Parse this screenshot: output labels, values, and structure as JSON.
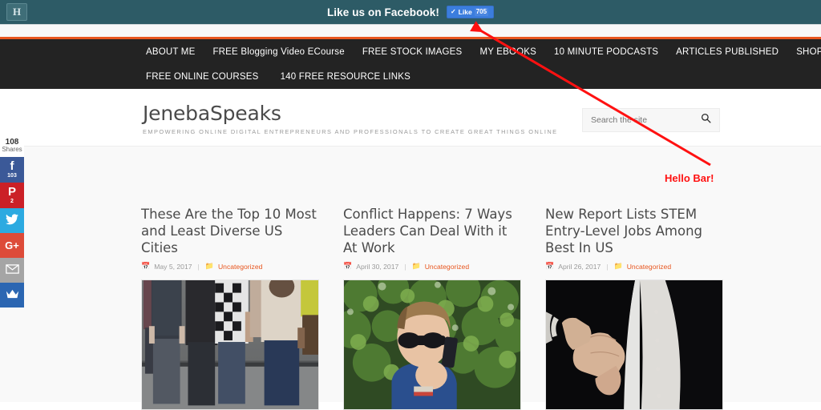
{
  "hellobar": {
    "logo_letter": "H",
    "message": "Like us on Facebook!",
    "like_button": {
      "check": "✓",
      "label": "Like",
      "count": "705"
    },
    "bar_color": "#2d5b66",
    "accent_color": "#e8561f"
  },
  "nav": {
    "row1": [
      {
        "label": "ABOUT ME"
      },
      {
        "label": "FREE Blogging Video ECourse"
      },
      {
        "label": "FREE STOCK IMAGES"
      },
      {
        "label": "MY EBOOKS"
      },
      {
        "label": "10 MINUTE PODCASTS"
      },
      {
        "label": "ARTICLES PUBLISHED"
      },
      {
        "label": "SHOP!"
      }
    ],
    "row2": [
      {
        "label": "FREE ONLINE COURSES"
      },
      {
        "label": "140 FREE RESOURCE LINKS"
      }
    ]
  },
  "masthead": {
    "site_title": "JenebaSpeaks",
    "tagline": "EMPOWERING ONLINE DIGITAL ENTREPRENEURS AND PROFESSIONALS TO CREATE GREAT THINGS ONLINE",
    "search": {
      "placeholder": "Search the site",
      "value": "",
      "icon": "search-icon"
    }
  },
  "share_rail": {
    "total_count": "108",
    "total_label": "Shares",
    "buttons": [
      {
        "network": "facebook",
        "glyph": "f",
        "count": "103",
        "color": "#3b5998"
      },
      {
        "network": "pinterest",
        "glyph": "P",
        "count": "2",
        "color": "#cb2027"
      },
      {
        "network": "twitter",
        "glyph": "🐦",
        "count": "",
        "color": "#2caae1"
      },
      {
        "network": "googleplus",
        "glyph": "G+",
        "count": "",
        "color": "#dd4b39"
      },
      {
        "network": "email",
        "glyph": "✉",
        "count": "",
        "color": "#a5a5a5"
      },
      {
        "network": "more",
        "glyph": "♛",
        "count": "",
        "color": "#2b66b2"
      }
    ]
  },
  "posts": [
    {
      "title": "These Are the Top 10 Most and Least Diverse US Cities",
      "date": "May 5, 2017",
      "separator": "|",
      "category": "Uncategorized",
      "image_alt": "group-of-diverse-people-standing"
    },
    {
      "title": "Conflict Happens: 7 Ways Leaders Can Deal With it At Work",
      "date": "April 30, 2017",
      "separator": "|",
      "category": "Uncategorized",
      "image_alt": "man-with-sunglasses-on-phone-outdoors"
    },
    {
      "title": "New Report Lists STEM Entry-Level Jobs Among Best In US",
      "date": "April 26, 2017",
      "separator": "|",
      "category": "Uncategorized",
      "image_alt": "businessman-offering-handshake"
    }
  ],
  "annotation": {
    "label": "Hello Bar!",
    "color": "#ff1111"
  }
}
